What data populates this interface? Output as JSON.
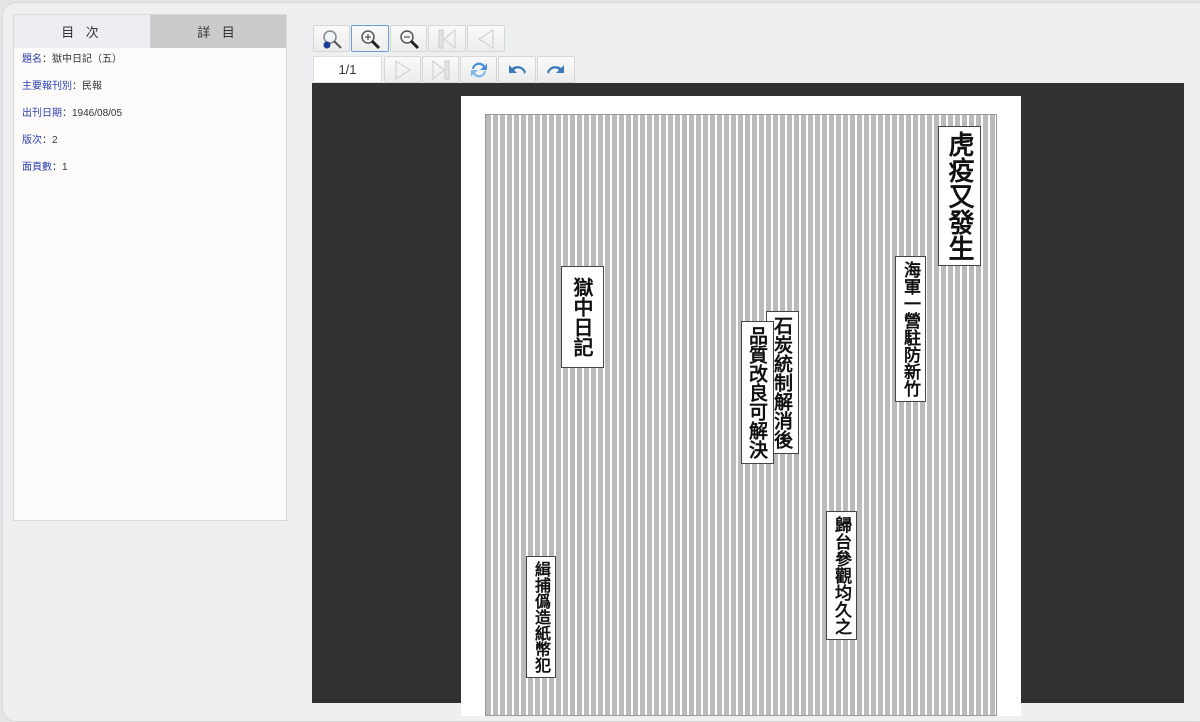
{
  "tabs": {
    "toc": "目 次",
    "detail": "詳 目"
  },
  "details": [
    {
      "key": "題名",
      "value": "獄中日記（五）"
    },
    {
      "key": "主要報刊別",
      "value": "民報"
    },
    {
      "key": "出刊日期",
      "value": "1946/08/05"
    },
    {
      "key": "版次",
      "value": "2"
    },
    {
      "key": "面頁數",
      "value": "1"
    }
  ],
  "viewer": {
    "page_indicator": "1/1"
  },
  "newspaper": {
    "headlines": [
      "虎疫又發生",
      "獄中日記",
      "石炭統制解消後",
      "品質改良可解決",
      "海軍一營駐防新竹",
      "歸台參觀均久之",
      "緝捕僞造紙幣犯"
    ]
  }
}
